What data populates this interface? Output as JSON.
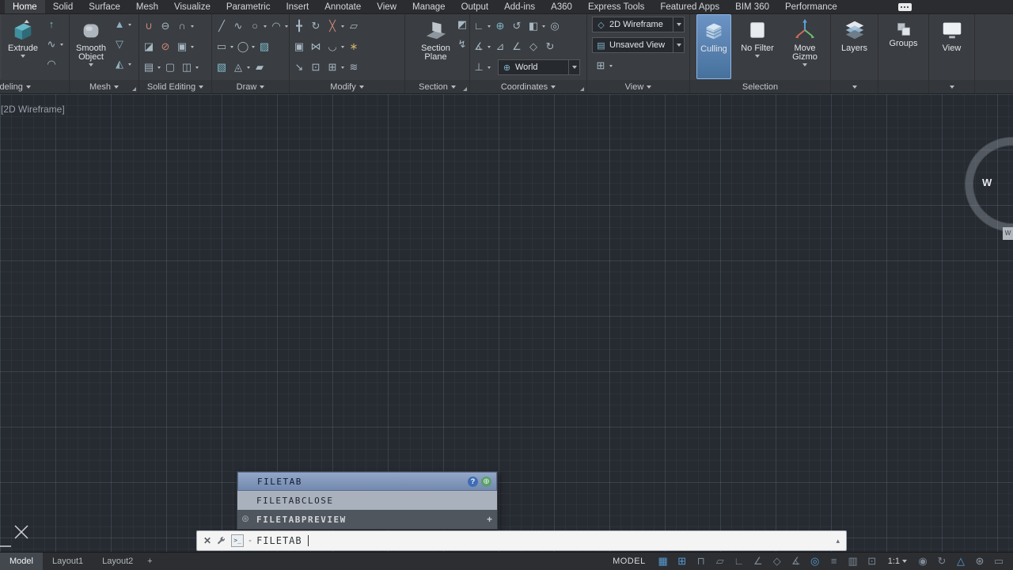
{
  "ribbon": {
    "tabs": [
      {
        "label": "Home",
        "active": true
      },
      {
        "label": "Solid"
      },
      {
        "label": "Surface"
      },
      {
        "label": "Mesh"
      },
      {
        "label": "Visualize"
      },
      {
        "label": "Parametric"
      },
      {
        "label": "Insert"
      },
      {
        "label": "Annotate"
      },
      {
        "label": "View"
      },
      {
        "label": "Manage"
      },
      {
        "label": "Output"
      },
      {
        "label": "Add-ins"
      },
      {
        "label": "A360"
      },
      {
        "label": "Express Tools"
      },
      {
        "label": "Featured Apps"
      },
      {
        "label": "BIM 360"
      },
      {
        "label": "Performance"
      }
    ],
    "panels": {
      "modeling": {
        "label": "Modeling",
        "extrude_label": "Extrude"
      },
      "mesh": {
        "label": "Mesh",
        "smooth_object_label": "Smooth Object"
      },
      "solid_editing": {
        "label": "Solid Editing"
      },
      "draw": {
        "label": "Draw"
      },
      "modify": {
        "label": "Modify"
      },
      "section": {
        "label": "Section",
        "section_plane_label": "Section Plane"
      },
      "coordinates": {
        "label": "Coordinates",
        "ucs_combo_value": "World"
      },
      "view": {
        "label": "View",
        "visual_style_value": "2D Wireframe",
        "view_combo_value": "Unsaved View"
      },
      "selection": {
        "label": "Selection",
        "culling_label": "Culling",
        "no_filter_label": "No Filter",
        "move_gizmo_label": "Move Gizmo"
      },
      "layers": {
        "button_label": "Layers"
      },
      "groups": {
        "button_label": "Groups"
      },
      "view_tools": {
        "button_label": "View"
      }
    },
    "combo_icons": {
      "visual_style": "◇",
      "named_view": "▤",
      "world": "⊕"
    },
    "icons": {
      "modeling_mini": [
        {
          "name": "presspull-icon",
          "glyph": "↑",
          "color": "#7fb9c9",
          "arrow": false
        },
        {
          "name": "sweep-icon",
          "glyph": "∿",
          "color": "#a7b8c4",
          "arrow": true
        },
        {
          "name": "loft-icon",
          "glyph": "◠",
          "color": "#a7b8c4",
          "arrow": false
        }
      ],
      "mesh_mini": [
        {
          "name": "smooth-more-icon",
          "glyph": "▲",
          "color": "#8fb0c0",
          "arrow": true
        },
        {
          "name": "smooth-less-icon",
          "glyph": "▽",
          "color": "#8fb0c0",
          "arrow": false
        },
        {
          "name": "refine-mesh-icon",
          "glyph": "◭",
          "color": "#8fb0c0",
          "arrow": true
        }
      ],
      "solid_row1": [
        {
          "name": "union-icon",
          "glyph": "∪",
          "color": "#c98a7a",
          "arrow": false
        },
        {
          "name": "subtract-icon",
          "glyph": "⊖",
          "color": "#a7b8c4",
          "arrow": false
        },
        {
          "name": "intersect-icon",
          "glyph": "∩",
          "color": "#a7b8c4",
          "arrow": true
        }
      ],
      "solid_row2": [
        {
          "name": "slice-icon",
          "glyph": "◪",
          "color": "#a7b8c4",
          "arrow": false
        },
        {
          "name": "interfere-icon",
          "glyph": "⊘",
          "color": "#c98a7a",
          "arrow": false
        },
        {
          "name": "thicken-icon",
          "glyph": "▣",
          "color": "#a7b8c4",
          "arrow": true
        }
      ],
      "solid_row3": [
        {
          "name": "extract-edges-icon",
          "glyph": "▤",
          "color": "#a7b8c4",
          "arrow": true
        },
        {
          "name": "imprint-icon",
          "glyph": "▢",
          "color": "#a7b8c4",
          "arrow": false
        },
        {
          "name": "shell-icon",
          "glyph": "◫",
          "color": "#a7b8c4",
          "arrow": true
        }
      ],
      "draw_row1": [
        {
          "name": "line-icon",
          "glyph": "╱",
          "color": "#a7b8c4",
          "arrow": false
        },
        {
          "name": "polyline-icon",
          "glyph": "∿",
          "color": "#a7b8c4",
          "arrow": false
        },
        {
          "name": "circle-icon",
          "glyph": "○",
          "color": "#a7b8c4",
          "arrow": true
        },
        {
          "name": "arc-icon",
          "glyph": "◠",
          "color": "#a7b8c4",
          "arrow": true
        }
      ],
      "draw_row2": [
        {
          "name": "rectangle-icon",
          "glyph": "▭",
          "color": "#a7b8c4",
          "arrow": true
        },
        {
          "name": "ellipse-icon",
          "glyph": "◯",
          "color": "#a7b8c4",
          "arrow": true
        },
        {
          "name": "hatch-icon",
          "glyph": "▨",
          "color": "#7fb9c9",
          "arrow": false
        }
      ],
      "draw_row3": [
        {
          "name": "gradient-icon",
          "glyph": "▧",
          "color": "#7fb9c9",
          "arrow": false
        },
        {
          "name": "boundary-icon",
          "glyph": "◬",
          "color": "#a7b8c4",
          "arrow": true
        },
        {
          "name": "region-icon",
          "glyph": "▰",
          "color": "#a7b8c4",
          "arrow": false
        }
      ],
      "modify_row1": [
        {
          "name": "move-icon",
          "glyph": "╋",
          "color": "#a7b8c4",
          "arrow": false
        },
        {
          "name": "rotate-icon",
          "glyph": "↻",
          "color": "#a7b8c4",
          "arrow": false
        },
        {
          "name": "trim-icon",
          "glyph": "╳",
          "color": "#c98a7a",
          "arrow": true
        },
        {
          "name": "erase-icon",
          "glyph": "▱",
          "color": "#a7b8c4",
          "arrow": false
        }
      ],
      "modify_row2": [
        {
          "name": "copy-icon",
          "glyph": "▣",
          "color": "#a7b8c4",
          "arrow": false
        },
        {
          "name": "mirror-icon",
          "glyph": "⋈",
          "color": "#a7b8c4",
          "arrow": false
        },
        {
          "name": "fillet-icon",
          "glyph": "◡",
          "color": "#a7b8c4",
          "arrow": true
        },
        {
          "name": "explode-icon",
          "glyph": "∗",
          "color": "#c9b06a",
          "arrow": false
        }
      ],
      "modify_row3": [
        {
          "name": "stretch-icon",
          "glyph": "↘",
          "color": "#a7b8c4",
          "arrow": false
        },
        {
          "name": "scale-icon",
          "glyph": "⊡",
          "color": "#a7b8c4",
          "arrow": false
        },
        {
          "name": "array-icon",
          "glyph": "⊞",
          "color": "#a7b8c4",
          "arrow": true
        },
        {
          "name": "offset-icon",
          "glyph": "≋",
          "color": "#a7b8c4",
          "arrow": false
        }
      ],
      "section_mini": [
        {
          "name": "live-section-icon",
          "glyph": "◩",
          "color": "#a7b8c4",
          "arrow": false
        },
        {
          "name": "add-jog-icon",
          "glyph": "↯",
          "color": "#a7b8c4",
          "arrow": false
        }
      ],
      "coord_row1": [
        {
          "name": "ucs-icon",
          "glyph": "∟",
          "color": "#a7b8c4",
          "arrow": true
        },
        {
          "name": "ucs-world-icon",
          "glyph": "⊕",
          "color": "#7fb9c9",
          "arrow": false
        },
        {
          "name": "ucs-previous-icon",
          "glyph": "↺",
          "color": "#a7b8c4",
          "arrow": false
        },
        {
          "name": "ucs-face-icon",
          "glyph": "◧",
          "color": "#a7b8c4",
          "arrow": true
        },
        {
          "name": "ucs-object-icon",
          "glyph": "◎",
          "color": "#a7b8c4",
          "arrow": false
        }
      ],
      "coord_row2": [
        {
          "name": "ucs-origin-icon",
          "glyph": "∡",
          "color": "#a7b8c4",
          "arrow": true
        },
        {
          "name": "ucs-zaxis-icon",
          "glyph": "⊿",
          "color": "#a7b8c4",
          "arrow": false
        },
        {
          "name": "ucs-3point-icon",
          "glyph": "∠",
          "color": "#a7b8c4",
          "arrow": false
        },
        {
          "name": "ucs-x-icon",
          "glyph": "◇",
          "color": "#a7b8c4",
          "arrow": false
        },
        {
          "name": "ucs-named-icon",
          "glyph": "↻",
          "color": "#a7b8c4",
          "arrow": false
        }
      ],
      "coord_row3_icon": [
        {
          "name": "show-ucs-icon",
          "glyph": "⊥",
          "color": "#a7b8c4",
          "arrow": true
        }
      ],
      "view_row3": [
        {
          "name": "viewport-config-icon",
          "glyph": "⊞",
          "color": "#a7b8c4",
          "arrow": true
        }
      ]
    }
  },
  "viewport": {
    "control_label": "[2D Wireframe]",
    "viewcube_label": "W",
    "ucs_chip": "W"
  },
  "autocomplete": {
    "help_glyph": "?",
    "web_glyph": "⊕",
    "gear_glyph": "⊛",
    "rows": [
      {
        "label": "FILETAB",
        "selected": true
      },
      {
        "label": "FILETABCLOSE"
      },
      {
        "label": "FILETABPREVIEW",
        "sysvar": true,
        "plus": "+"
      }
    ]
  },
  "command": {
    "prompt_glyph": ">_",
    "value": "FILETAB"
  },
  "statusbar": {
    "layout_tabs": [
      {
        "label": "Model",
        "active": true
      },
      {
        "label": "Layout1"
      },
      {
        "label": "Layout2"
      }
    ],
    "new_layout_label": "+",
    "model_label": "MODEL",
    "scale_label": "1:1",
    "icons_a": [
      {
        "name": "grid-icon",
        "glyph": "▦",
        "color": "#579bd5"
      },
      {
        "name": "snap-icon",
        "glyph": "⊞",
        "color": "#579bd5"
      },
      {
        "name": "infer-constraints-icon",
        "glyph": "⊓",
        "color": "#7b8794"
      },
      {
        "name": "dynamic-input-icon",
        "glyph": "▱",
        "color": "#7b8794"
      },
      {
        "name": "ortho-icon",
        "glyph": "∟",
        "color": "#7b8794"
      },
      {
        "name": "polar-tracking-icon",
        "glyph": "∠",
        "color": "#7b8794"
      },
      {
        "name": "isodraft-icon",
        "glyph": "◇",
        "color": "#7b8794"
      },
      {
        "name": "osnap-tracking-icon",
        "glyph": "∡",
        "color": "#7b8794"
      },
      {
        "name": "osnap-icon",
        "glyph": "◎",
        "color": "#579bd5"
      },
      {
        "name": "lineweight-icon",
        "glyph": "≡",
        "color": "#7b8794"
      },
      {
        "name": "transparency-icon",
        "glyph": "▥",
        "color": "#7b8794"
      },
      {
        "name": "selection-cycling-icon",
        "glyph": "⊡",
        "color": "#7b8794"
      }
    ],
    "icons_b": [
      {
        "name": "annotation-visibility-icon",
        "glyph": "◉",
        "color": "#7b8794"
      },
      {
        "name": "autoscale-icon",
        "glyph": "↻",
        "color": "#7b8794"
      },
      {
        "name": "annotation-scale-icon",
        "glyph": "△",
        "color": "#579bd5"
      },
      {
        "name": "customization-icon",
        "glyph": "⊛",
        "color": "#8e98a3"
      },
      {
        "name": "clean-screen-icon",
        "glyph": "▭",
        "color": "#7b8794"
      }
    ]
  }
}
